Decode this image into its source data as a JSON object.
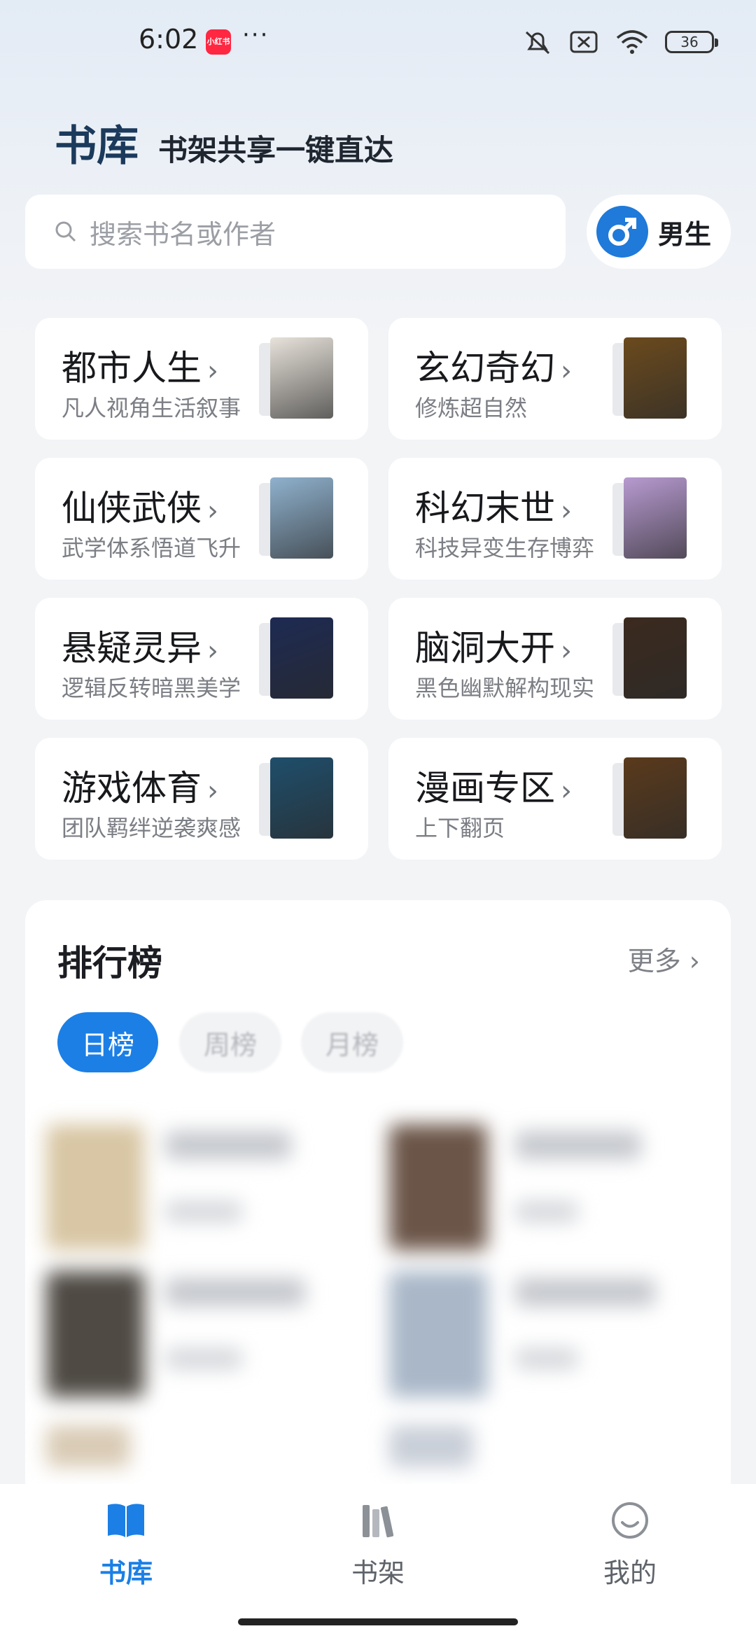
{
  "status_bar": {
    "time": "6:02",
    "app_badge": "小红书",
    "more": "···",
    "battery": "36"
  },
  "header": {
    "title": "书库",
    "subtitle": "书架共享一键直达"
  },
  "search": {
    "placeholder": "搜索书名或作者"
  },
  "gender_toggle": {
    "label": "男生",
    "color": "#1f7ad9"
  },
  "categories": [
    {
      "title": "都市人生",
      "desc": "凡人视角生活叙事",
      "cover_color": "#e7e2da"
    },
    {
      "title": "玄幻奇幻",
      "desc": "修炼超自然",
      "cover_color": "#6b4a1d"
    },
    {
      "title": "仙侠武侠",
      "desc": "武学体系悟道飞升",
      "cover_color": "#8fb1cd"
    },
    {
      "title": "科幻末世",
      "desc": "科技异变生存博弈",
      "cover_color": "#b79ad0"
    },
    {
      "title": "悬疑灵异",
      "desc": "逻辑反转暗黑美学",
      "cover_color": "#1d2a52"
    },
    {
      "title": "脑洞大开",
      "desc": "黑色幽默解构现实",
      "cover_color": "#3b2a1e"
    },
    {
      "title": "游戏体育",
      "desc": "团队羁绊逆袭爽感",
      "cover_color": "#1f4e6b"
    },
    {
      "title": "漫画专区",
      "desc": "上下翻页",
      "cover_color": "#5a3a1c"
    }
  ],
  "ranking": {
    "title": "排行榜",
    "more": "更多 ›",
    "tabs": [
      "日榜",
      "周榜",
      "月榜"
    ],
    "active_tab": "日榜"
  },
  "bottom_nav": [
    {
      "label": "书库",
      "active": true,
      "icon": "open-book-icon"
    },
    {
      "label": "书架",
      "active": false,
      "icon": "bookshelf-icon"
    },
    {
      "label": "我的",
      "active": false,
      "icon": "smiley-icon"
    }
  ],
  "colors": {
    "accent": "#1b7fe6",
    "header_title": "#1b3a5c"
  }
}
